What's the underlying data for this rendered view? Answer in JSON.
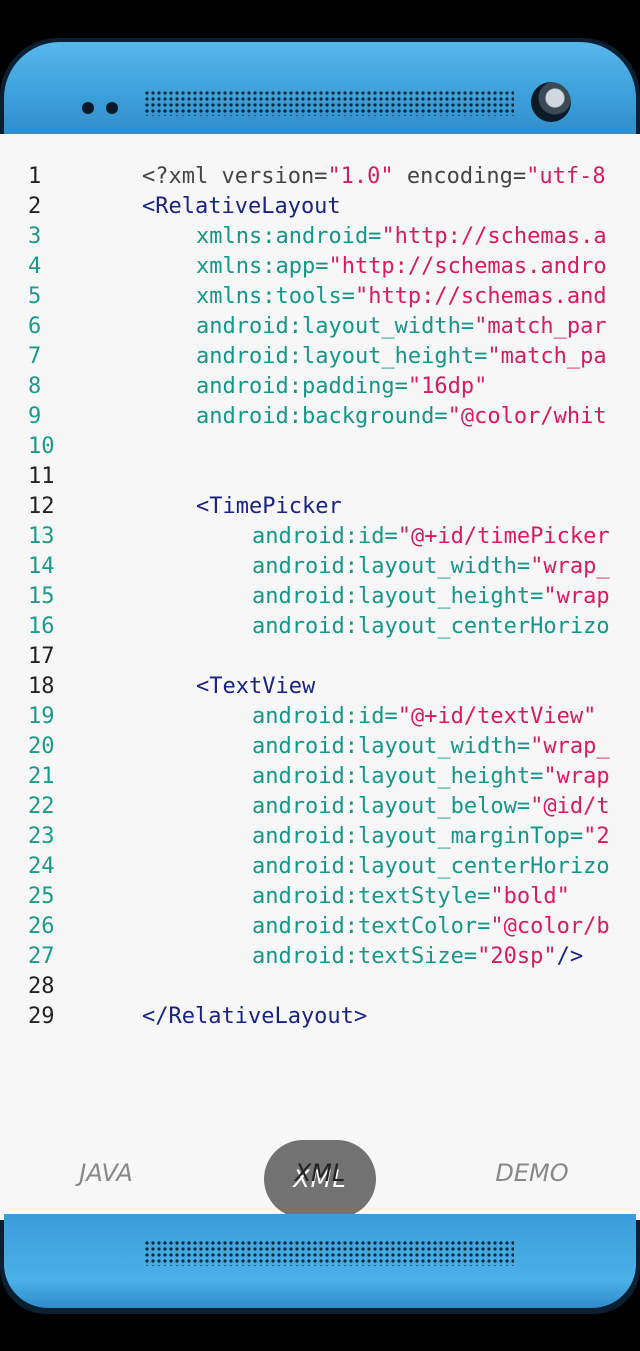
{
  "code_lines": [
    {
      "n": "1",
      "html": [
        {
          "c": "pi",
          "t": "<?xml version="
        },
        {
          "c": "str",
          "t": "\"1.0\""
        },
        {
          "c": "pi",
          "t": " encoding="
        },
        {
          "c": "str",
          "t": "\"utf-8"
        }
      ]
    },
    {
      "n": "2",
      "html": [
        {
          "c": "tag",
          "t": "<RelativeLayout"
        }
      ]
    },
    {
      "n": "3",
      "html": [
        {
          "c": "attr",
          "t": "xmlns:android="
        },
        {
          "c": "str",
          "t": "\"http://schemas.a"
        }
      ]
    },
    {
      "n": "4",
      "html": [
        {
          "c": "attr",
          "t": "xmlns:app="
        },
        {
          "c": "str",
          "t": "\"http://schemas.andro"
        }
      ]
    },
    {
      "n": "5",
      "html": [
        {
          "c": "attr",
          "t": "xmlns:tools="
        },
        {
          "c": "str",
          "t": "\"http://schemas.and"
        }
      ]
    },
    {
      "n": "6",
      "html": [
        {
          "c": "attr",
          "t": "android:layout_width="
        },
        {
          "c": "str",
          "t": "\"match_par"
        }
      ]
    },
    {
      "n": "7",
      "html": [
        {
          "c": "attr",
          "t": "android:layout_height="
        },
        {
          "c": "str",
          "t": "\"match_pa"
        }
      ]
    },
    {
      "n": "8",
      "html": [
        {
          "c": "attr",
          "t": "android:padding="
        },
        {
          "c": "str",
          "t": "\"16dp\""
        }
      ]
    },
    {
      "n": "9",
      "html": [
        {
          "c": "attr",
          "t": "android:background="
        },
        {
          "c": "str",
          "t": "\"@color/whit"
        }
      ]
    },
    {
      "n": "10",
      "html": []
    },
    {
      "n": "11",
      "html": []
    },
    {
      "n": "12",
      "html": [
        {
          "c": "tag",
          "t": "<TimePicker"
        }
      ]
    },
    {
      "n": "13",
      "html": [
        {
          "c": "attr",
          "t": "android:id="
        },
        {
          "c": "str",
          "t": "\"@+id/timePicker"
        }
      ]
    },
    {
      "n": "14",
      "html": [
        {
          "c": "attr",
          "t": "android:layout_width="
        },
        {
          "c": "str",
          "t": "\"wrap_"
        }
      ]
    },
    {
      "n": "15",
      "html": [
        {
          "c": "attr",
          "t": "android:layout_height="
        },
        {
          "c": "str",
          "t": "\"wrap"
        }
      ]
    },
    {
      "n": "16",
      "html": [
        {
          "c": "attr",
          "t": "android:layout_centerHorizo"
        }
      ]
    },
    {
      "n": "17",
      "html": []
    },
    {
      "n": "18",
      "html": [
        {
          "c": "tag",
          "t": "<TextView"
        }
      ]
    },
    {
      "n": "19",
      "html": [
        {
          "c": "attr",
          "t": "android:id="
        },
        {
          "c": "str",
          "t": "\"@+id/textView\""
        }
      ]
    },
    {
      "n": "20",
      "html": [
        {
          "c": "attr",
          "t": "android:layout_width="
        },
        {
          "c": "str",
          "t": "\"wrap_"
        }
      ]
    },
    {
      "n": "21",
      "html": [
        {
          "c": "attr",
          "t": "android:layout_height="
        },
        {
          "c": "str",
          "t": "\"wrap"
        }
      ]
    },
    {
      "n": "22",
      "html": [
        {
          "c": "attr",
          "t": "android:layout_below="
        },
        {
          "c": "str",
          "t": "\"@id/t"
        }
      ]
    },
    {
      "n": "23",
      "html": [
        {
          "c": "attr",
          "t": "android:layout_marginTop="
        },
        {
          "c": "str",
          "t": "\"2"
        }
      ]
    },
    {
      "n": "24",
      "html": [
        {
          "c": "attr",
          "t": "android:layout_centerHorizo"
        }
      ]
    },
    {
      "n": "25",
      "html": [
        {
          "c": "attr",
          "t": "android:textStyle="
        },
        {
          "c": "str",
          "t": "\"bold\""
        }
      ]
    },
    {
      "n": "26",
      "html": [
        {
          "c": "attr",
          "t": "android:textColor="
        },
        {
          "c": "str",
          "t": "\"@color/b"
        }
      ]
    },
    {
      "n": "27",
      "html": [
        {
          "c": "attr",
          "t": "android:textSize="
        },
        {
          "c": "str",
          "t": "\"20sp\""
        },
        {
          "c": "tag",
          "t": "/>"
        }
      ]
    },
    {
      "n": "28",
      "html": []
    },
    {
      "n": "29",
      "html": [
        {
          "c": "tag",
          "t": "</RelativeLayout>"
        }
      ]
    }
  ],
  "fab": {
    "label": "XML"
  },
  "tabs": {
    "java": "JAVA",
    "xml": "XML",
    "demo": "DEMO"
  },
  "colors": {
    "bezel": "#3c9ed9",
    "tag": "#1a237e",
    "attr": "#159688",
    "string": "#d81b60"
  }
}
